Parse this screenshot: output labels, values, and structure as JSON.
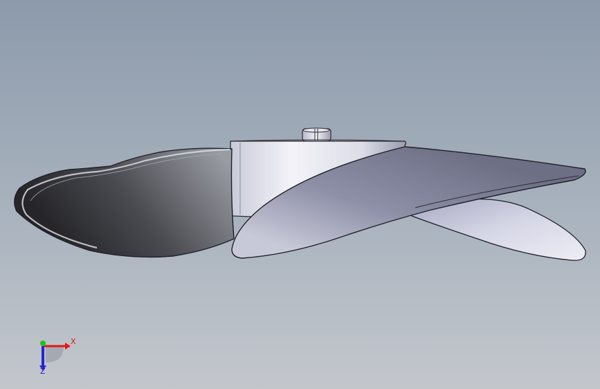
{
  "viewport": {
    "background_top": "#8c9aab",
    "background_bottom": "#c3c7cc"
  },
  "triad": {
    "x_label": "X",
    "z_label": "Z",
    "x_color": "#e01818",
    "y_color": "#1cc41c",
    "z_color": "#2424d8"
  }
}
